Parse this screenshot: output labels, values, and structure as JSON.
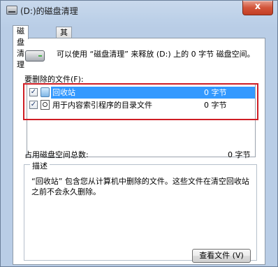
{
  "window": {
    "title": "(D:)的磁盘清理",
    "close_label": "x"
  },
  "tabs": [
    {
      "label": "磁盘清理",
      "active": true
    },
    {
      "label": "其他选项",
      "active": false
    }
  ],
  "intro_text": "可以使用 “磁盘清理” 来释放  (D:) 上的 0 字节 磁盘空间。",
  "files_label": "要删除的文件(F):",
  "files": [
    {
      "checked": true,
      "icon": "recycle-bin-icon",
      "name": "回收站",
      "size": "0 字节",
      "selected": true
    },
    {
      "checked": true,
      "icon": "search-index-icon",
      "name": "用于内容索引程序的目录文件",
      "size": "0 字节",
      "selected": false
    }
  ],
  "total": {
    "label": "占用磁盘空间总数:",
    "value": "0 字节"
  },
  "description": {
    "label": "描述",
    "text": "“回收站” 包含您从计算机中删除的文件。这些文件在清空回收站之前不会永久删除。"
  },
  "view_files_button": "查看文件 (V)",
  "colors": {
    "highlight": "#3399ff",
    "annotation_box": "#cf1d24"
  }
}
